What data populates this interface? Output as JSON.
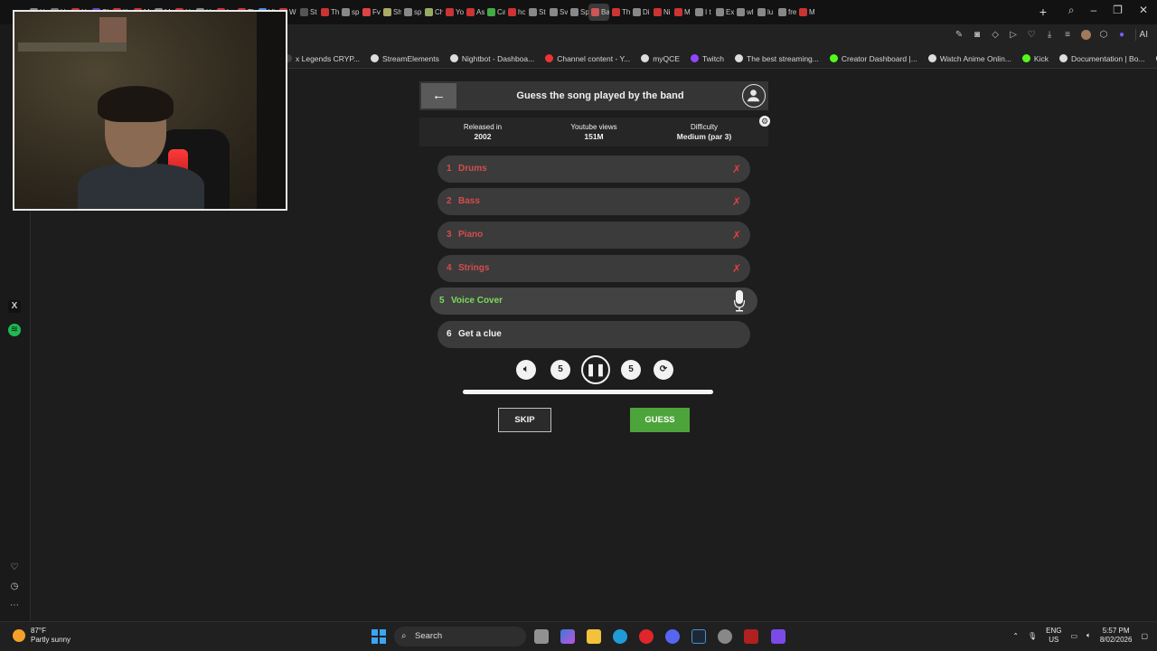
{
  "browser": {
    "tabs": [
      {
        "label": "H",
        "color": "#888"
      },
      {
        "label": "H",
        "color": "#777"
      },
      {
        "label": "H",
        "color": "#c33"
      },
      {
        "label": "Sh",
        "color": "#6b3fc9"
      },
      {
        "label": "Kr",
        "color": "#c33"
      },
      {
        "label": "M",
        "color": "#c33"
      },
      {
        "label": "M",
        "color": "#888"
      },
      {
        "label": "Ho",
        "color": "#c33"
      },
      {
        "label": "Ho",
        "color": "#888"
      },
      {
        "label": "hc",
        "color": "#c33"
      },
      {
        "label": "Th",
        "color": "#c33"
      },
      {
        "label": "Vi",
        "color": "#4a8ae6"
      },
      {
        "label": "W",
        "color": "#c33"
      },
      {
        "label": "St",
        "color": "#555"
      },
      {
        "label": "Th",
        "color": "#c33"
      },
      {
        "label": "sp",
        "color": "#888"
      },
      {
        "label": "Fv",
        "color": "#d44"
      },
      {
        "label": "Sh",
        "color": "#aa6"
      },
      {
        "label": "sp",
        "color": "#888"
      },
      {
        "label": "Ch",
        "color": "#9a6"
      },
      {
        "label": "Yo",
        "color": "#c33"
      },
      {
        "label": "As",
        "color": "#c33"
      },
      {
        "label": "Ca",
        "color": "#4a4"
      },
      {
        "label": "hc",
        "color": "#c33"
      },
      {
        "label": "St",
        "color": "#888"
      },
      {
        "label": "Sv",
        "color": "#888"
      },
      {
        "label": "Sp",
        "color": "#888"
      },
      {
        "label": "Ba",
        "color": "#c55"
      },
      {
        "label": "Th",
        "color": "#c33"
      },
      {
        "label": "Di",
        "color": "#888"
      },
      {
        "label": "Ni",
        "color": "#c33"
      },
      {
        "label": "M",
        "color": "#c33"
      },
      {
        "label": "I t",
        "color": "#888"
      },
      {
        "label": "Ex",
        "color": "#888"
      },
      {
        "label": "wl",
        "color": "#888"
      },
      {
        "label": "lu",
        "color": "#888"
      },
      {
        "label": "fre",
        "color": "#888"
      },
      {
        "label": "M",
        "color": "#c33"
      }
    ],
    "new_tab_label": "+",
    "ai_label": "AI",
    "bookmarks": [
      {
        "label": "x Legends CRYP...",
        "color": "#444"
      },
      {
        "label": "StreamElements",
        "color": "#ddd"
      },
      {
        "label": "Nightbot - Dashboa...",
        "color": "#ddd"
      },
      {
        "label": "Channel content - Y...",
        "color": "#e33"
      },
      {
        "label": "myQCE",
        "color": "#ddd"
      },
      {
        "label": "Twitch",
        "color": "#9146ff"
      },
      {
        "label": "The best streaming...",
        "color": "#ddd"
      },
      {
        "label": "Creator Dashboard |...",
        "color": "#53fc18"
      },
      {
        "label": "Watch Anime Onlin...",
        "color": "#ddd"
      },
      {
        "label": "Kick",
        "color": "#53fc18"
      },
      {
        "label": "Documentation | Bo...",
        "color": "#ddd"
      },
      {
        "label": "ChatGPT",
        "color": "#ddd"
      }
    ]
  },
  "game": {
    "title": "Guess the song played by the band",
    "info": [
      {
        "label": "Released in",
        "value": "2002"
      },
      {
        "label": "Youtube views",
        "value": "151M"
      },
      {
        "label": "Difficulty",
        "value": "Medium (par 3)"
      }
    ],
    "rows": [
      {
        "num": "1",
        "label": "Drums",
        "state": "wrong",
        "mark": "✗"
      },
      {
        "num": "2",
        "label": "Bass",
        "state": "wrong",
        "mark": "✗"
      },
      {
        "num": "3",
        "label": "Piano",
        "state": "wrong",
        "mark": "✗"
      },
      {
        "num": "4",
        "label": "Strings",
        "state": "wrong",
        "mark": "✗"
      },
      {
        "num": "5",
        "label": "Voice Cover",
        "state": "current",
        "mark": ""
      },
      {
        "num": "6",
        "label": "Get a clue",
        "state": "clue",
        "mark": ""
      }
    ],
    "controls": {
      "back5_label": "5",
      "fwd5_label": "5"
    },
    "progress": 1.0,
    "skip_label": "SKIP",
    "guess_label": "GUESS",
    "colors": {
      "wrong": "#d44d4d",
      "current": "#7bdb5c",
      "guess_button": "#4da43a"
    }
  },
  "taskbar": {
    "weather_temp": "87°F",
    "weather_desc": "Partly sunny",
    "search_label": "Search",
    "lang_top": "ENG",
    "lang_bottom": "US",
    "time": "5:57 PM",
    "date": "8/02/2026"
  }
}
